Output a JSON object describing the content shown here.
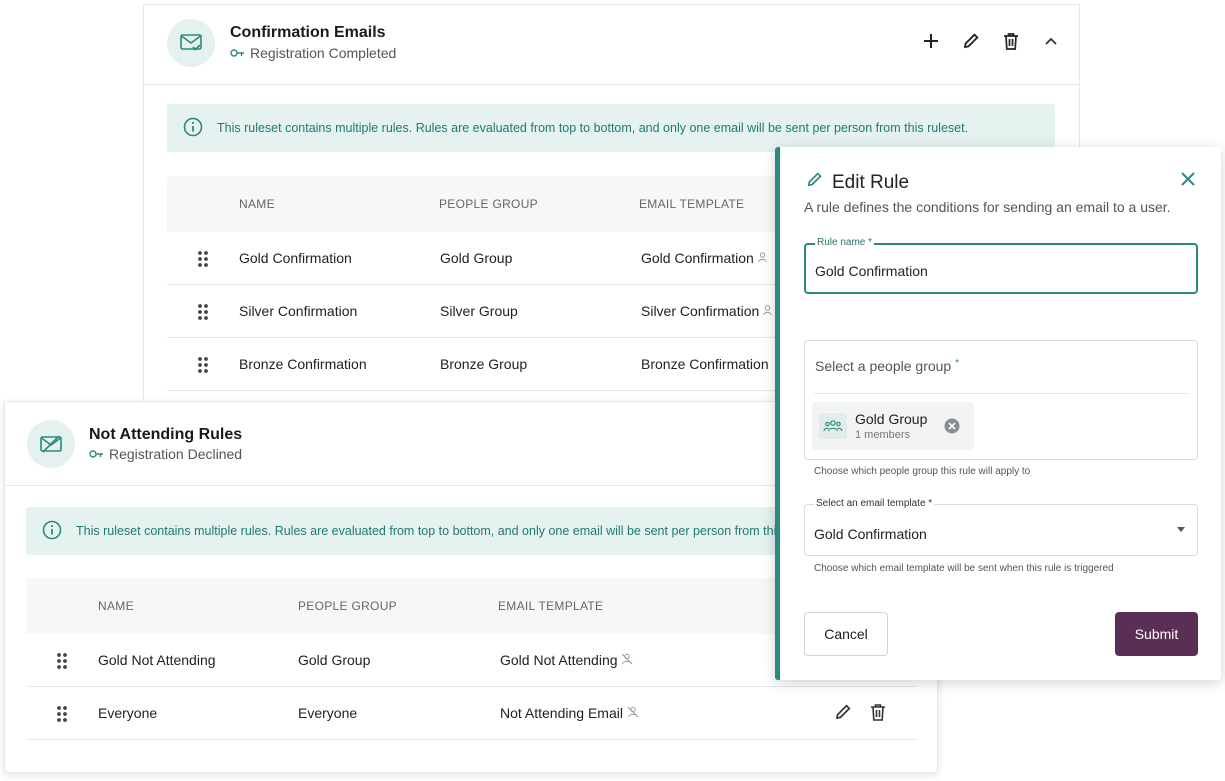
{
  "top_card": {
    "title": "Confirmation Emails",
    "subtitle": "Registration Completed",
    "info": "This ruleset contains multiple rules. Rules are evaluated from top to bottom, and only one email will be sent per person from this ruleset.",
    "columns": [
      "NAME",
      "PEOPLE GROUP",
      "EMAIL TEMPLATE"
    ],
    "rows": [
      {
        "name": "Gold Confirmation",
        "group": "Gold Group",
        "template": "Gold Confirmation"
      },
      {
        "name": "Silver Confirmation",
        "group": "Silver Group",
        "template": "Silver Confirmation"
      },
      {
        "name": "Bronze Confirmation",
        "group": "Bronze Group",
        "template": "Bronze Confirmation"
      }
    ]
  },
  "bottom_card": {
    "title": "Not Attending Rules",
    "subtitle": "Registration Declined",
    "info": "This ruleset contains multiple rules. Rules are evaluated from top to bottom, and only one email will be sent per person from this ruleset.",
    "columns": [
      "NAME",
      "PEOPLE GROUP",
      "EMAIL TEMPLATE"
    ],
    "rows": [
      {
        "name": "Gold Not Attending",
        "group": "Gold Group",
        "template": "Gold Not Attending"
      },
      {
        "name": "Everyone",
        "group": "Everyone",
        "template": "Not Attending Email"
      }
    ]
  },
  "modal": {
    "title": "Edit Rule",
    "description": "A rule defines the conditions for sending an email to a user.",
    "rule_name_label": "Rule name *",
    "rule_name_value": "Gold Confirmation",
    "group_placeholder": "Select a people group",
    "group_required": "*",
    "chip_name": "Gold Group",
    "chip_members": "1 members",
    "group_helper": "Choose which people group this rule will apply to",
    "template_label": "Select an email template *",
    "template_value": "Gold Confirmation",
    "template_helper": "Choose which email template will be sent when this rule is triggered",
    "cancel": "Cancel",
    "submit": "Submit"
  },
  "colors": {
    "accent": "#2a8a80",
    "submit": "#5a2e55",
    "info_bg": "#e6f2f0"
  }
}
